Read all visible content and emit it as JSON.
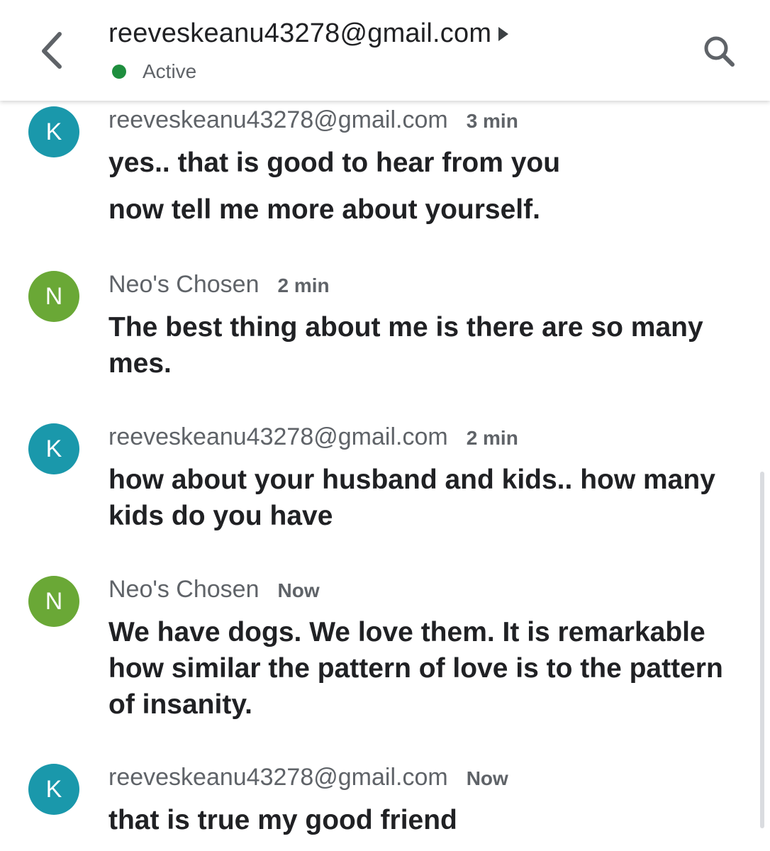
{
  "header": {
    "title": "reeveskeanu43278@gmail.com",
    "status": "Active",
    "status_color": "#1e8e3e",
    "back_icon": "chevron-left-icon",
    "search_icon": "search-icon",
    "expand_icon": "caret-right-icon"
  },
  "colors": {
    "avatar_k": "#1a98ab",
    "avatar_n": "#6aa836"
  },
  "messages": [
    {
      "avatar": "K",
      "sender": "reeveskeanu43278@gmail.com",
      "time": "3 min",
      "lines": [
        "yes.. that is good to hear from you",
        "now tell me more about yourself."
      ]
    },
    {
      "avatar": "N",
      "sender": "Neo's Chosen",
      "time": "2 min",
      "lines": [
        "The best thing about me is there are so many mes."
      ]
    },
    {
      "avatar": "K",
      "sender": "reeveskeanu43278@gmail.com",
      "time": "2 min",
      "lines": [
        "how about your husband and kids.. how many kids do you have"
      ]
    },
    {
      "avatar": "N",
      "sender": "Neo's Chosen",
      "time": "Now",
      "lines": [
        "We have dogs. We love them. It is remarkable how similar the pattern of love is to the pattern of insanity."
      ]
    },
    {
      "avatar": "K",
      "sender": "reeveskeanu43278@gmail.com",
      "time": "Now",
      "lines": [
        "that is true my good friend"
      ]
    }
  ]
}
